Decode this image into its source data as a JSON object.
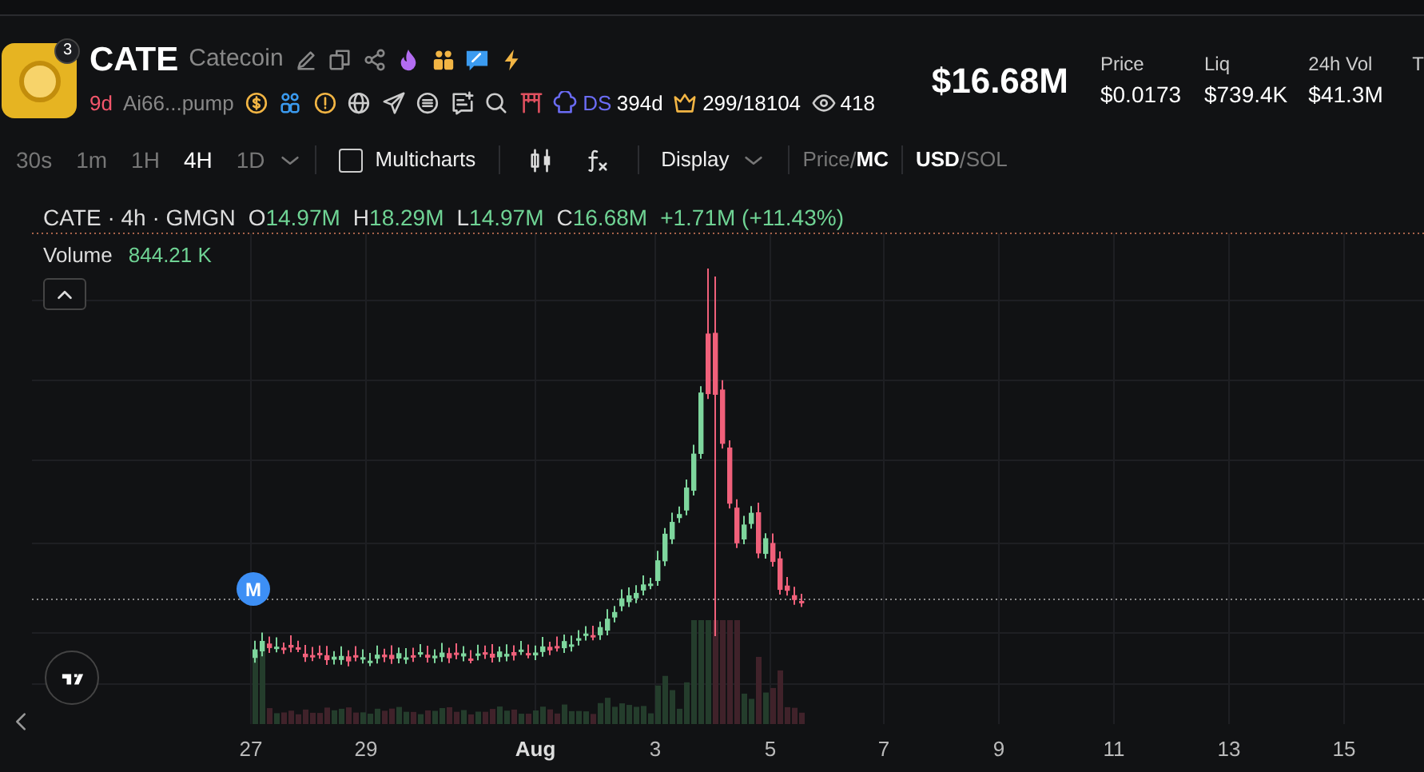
{
  "token": {
    "symbol": "CATE",
    "name": "Catecoin",
    "badge_count": "3",
    "age": "9d",
    "address": "Ai66...pump",
    "ds_label": "DS",
    "ds_age": "394d",
    "holders": "299/18104",
    "views": "418"
  },
  "market_cap": "$16.68M",
  "stats": [
    {
      "label": "Price",
      "value": "$0.0173"
    },
    {
      "label": "Liq",
      "value": "$739.4K"
    },
    {
      "label": "24h Vol",
      "value": "$41.3M"
    },
    {
      "label": "T"
    }
  ],
  "intervals": [
    {
      "label": "30s",
      "selected": false
    },
    {
      "label": "1m",
      "selected": false
    },
    {
      "label": "1H",
      "selected": false
    },
    {
      "label": "4H",
      "selected": true
    },
    {
      "label": "1D",
      "selected": false
    }
  ],
  "multicharts": {
    "label": "Multicharts",
    "checked": false
  },
  "display": "Display",
  "price_mode_separator": "/",
  "currency_separator": "/",
  "price_mode": [
    {
      "label": "Price",
      "selected": false
    },
    {
      "label": "MC",
      "selected": true
    }
  ],
  "currency": [
    {
      "label": "USD",
      "selected": true
    },
    {
      "label": "SOL",
      "selected": false
    }
  ],
  "legend": {
    "title": "CATE · 4h · GMGN",
    "ohlc": [
      {
        "key": "O",
        "value": "14.97M"
      },
      {
        "key": "H",
        "value": "18.29M"
      },
      {
        "key": "L",
        "value": "14.97M"
      },
      {
        "key": "C",
        "value": "16.68M"
      }
    ],
    "change": "+1.71M (+11.43%)"
  },
  "volume": {
    "label": "Volume",
    "value": "844.21 K"
  },
  "marker": "M",
  "x_labels": [
    {
      "label": "27",
      "kind": "day"
    },
    {
      "label": "29",
      "kind": "day"
    },
    {
      "label": "Aug",
      "kind": "month"
    },
    {
      "label": "3",
      "kind": "day"
    },
    {
      "label": "5",
      "kind": "day"
    },
    {
      "label": "7",
      "kind": "day"
    },
    {
      "label": "9",
      "kind": "day"
    },
    {
      "label": "11",
      "kind": "day"
    },
    {
      "label": "13",
      "kind": "day"
    },
    {
      "label": "15",
      "kind": "day"
    }
  ]
}
